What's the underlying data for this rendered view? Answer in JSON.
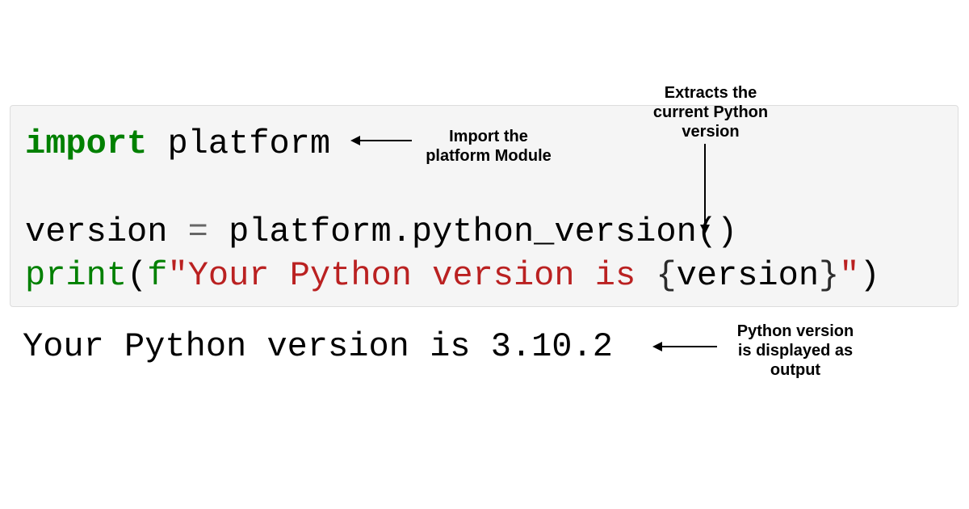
{
  "code": {
    "line1": {
      "import_kw": "import",
      "module": "platform"
    },
    "line2": {
      "var": "version",
      "eq": "=",
      "call": "platform.python_version",
      "parens": "()"
    },
    "line3": {
      "print_kw": "print",
      "open_paren": "(",
      "fprefix": "f",
      "quote_open": "\"",
      "str_part": "Your Python version is ",
      "brace_open": "{",
      "interp": "version",
      "brace_close": "}",
      "quote_close": "\"",
      "close_paren": ")"
    }
  },
  "output": "Your Python version is 3.10.2",
  "annotations": {
    "a1_line1": "Import the",
    "a1_line2": "platform Module",
    "a2_line1": "Extracts the",
    "a2_line2": "current Python",
    "a2_line3": "version",
    "a3_line1": "Python version",
    "a3_line2": "is displayed as",
    "a3_line3": "output"
  }
}
